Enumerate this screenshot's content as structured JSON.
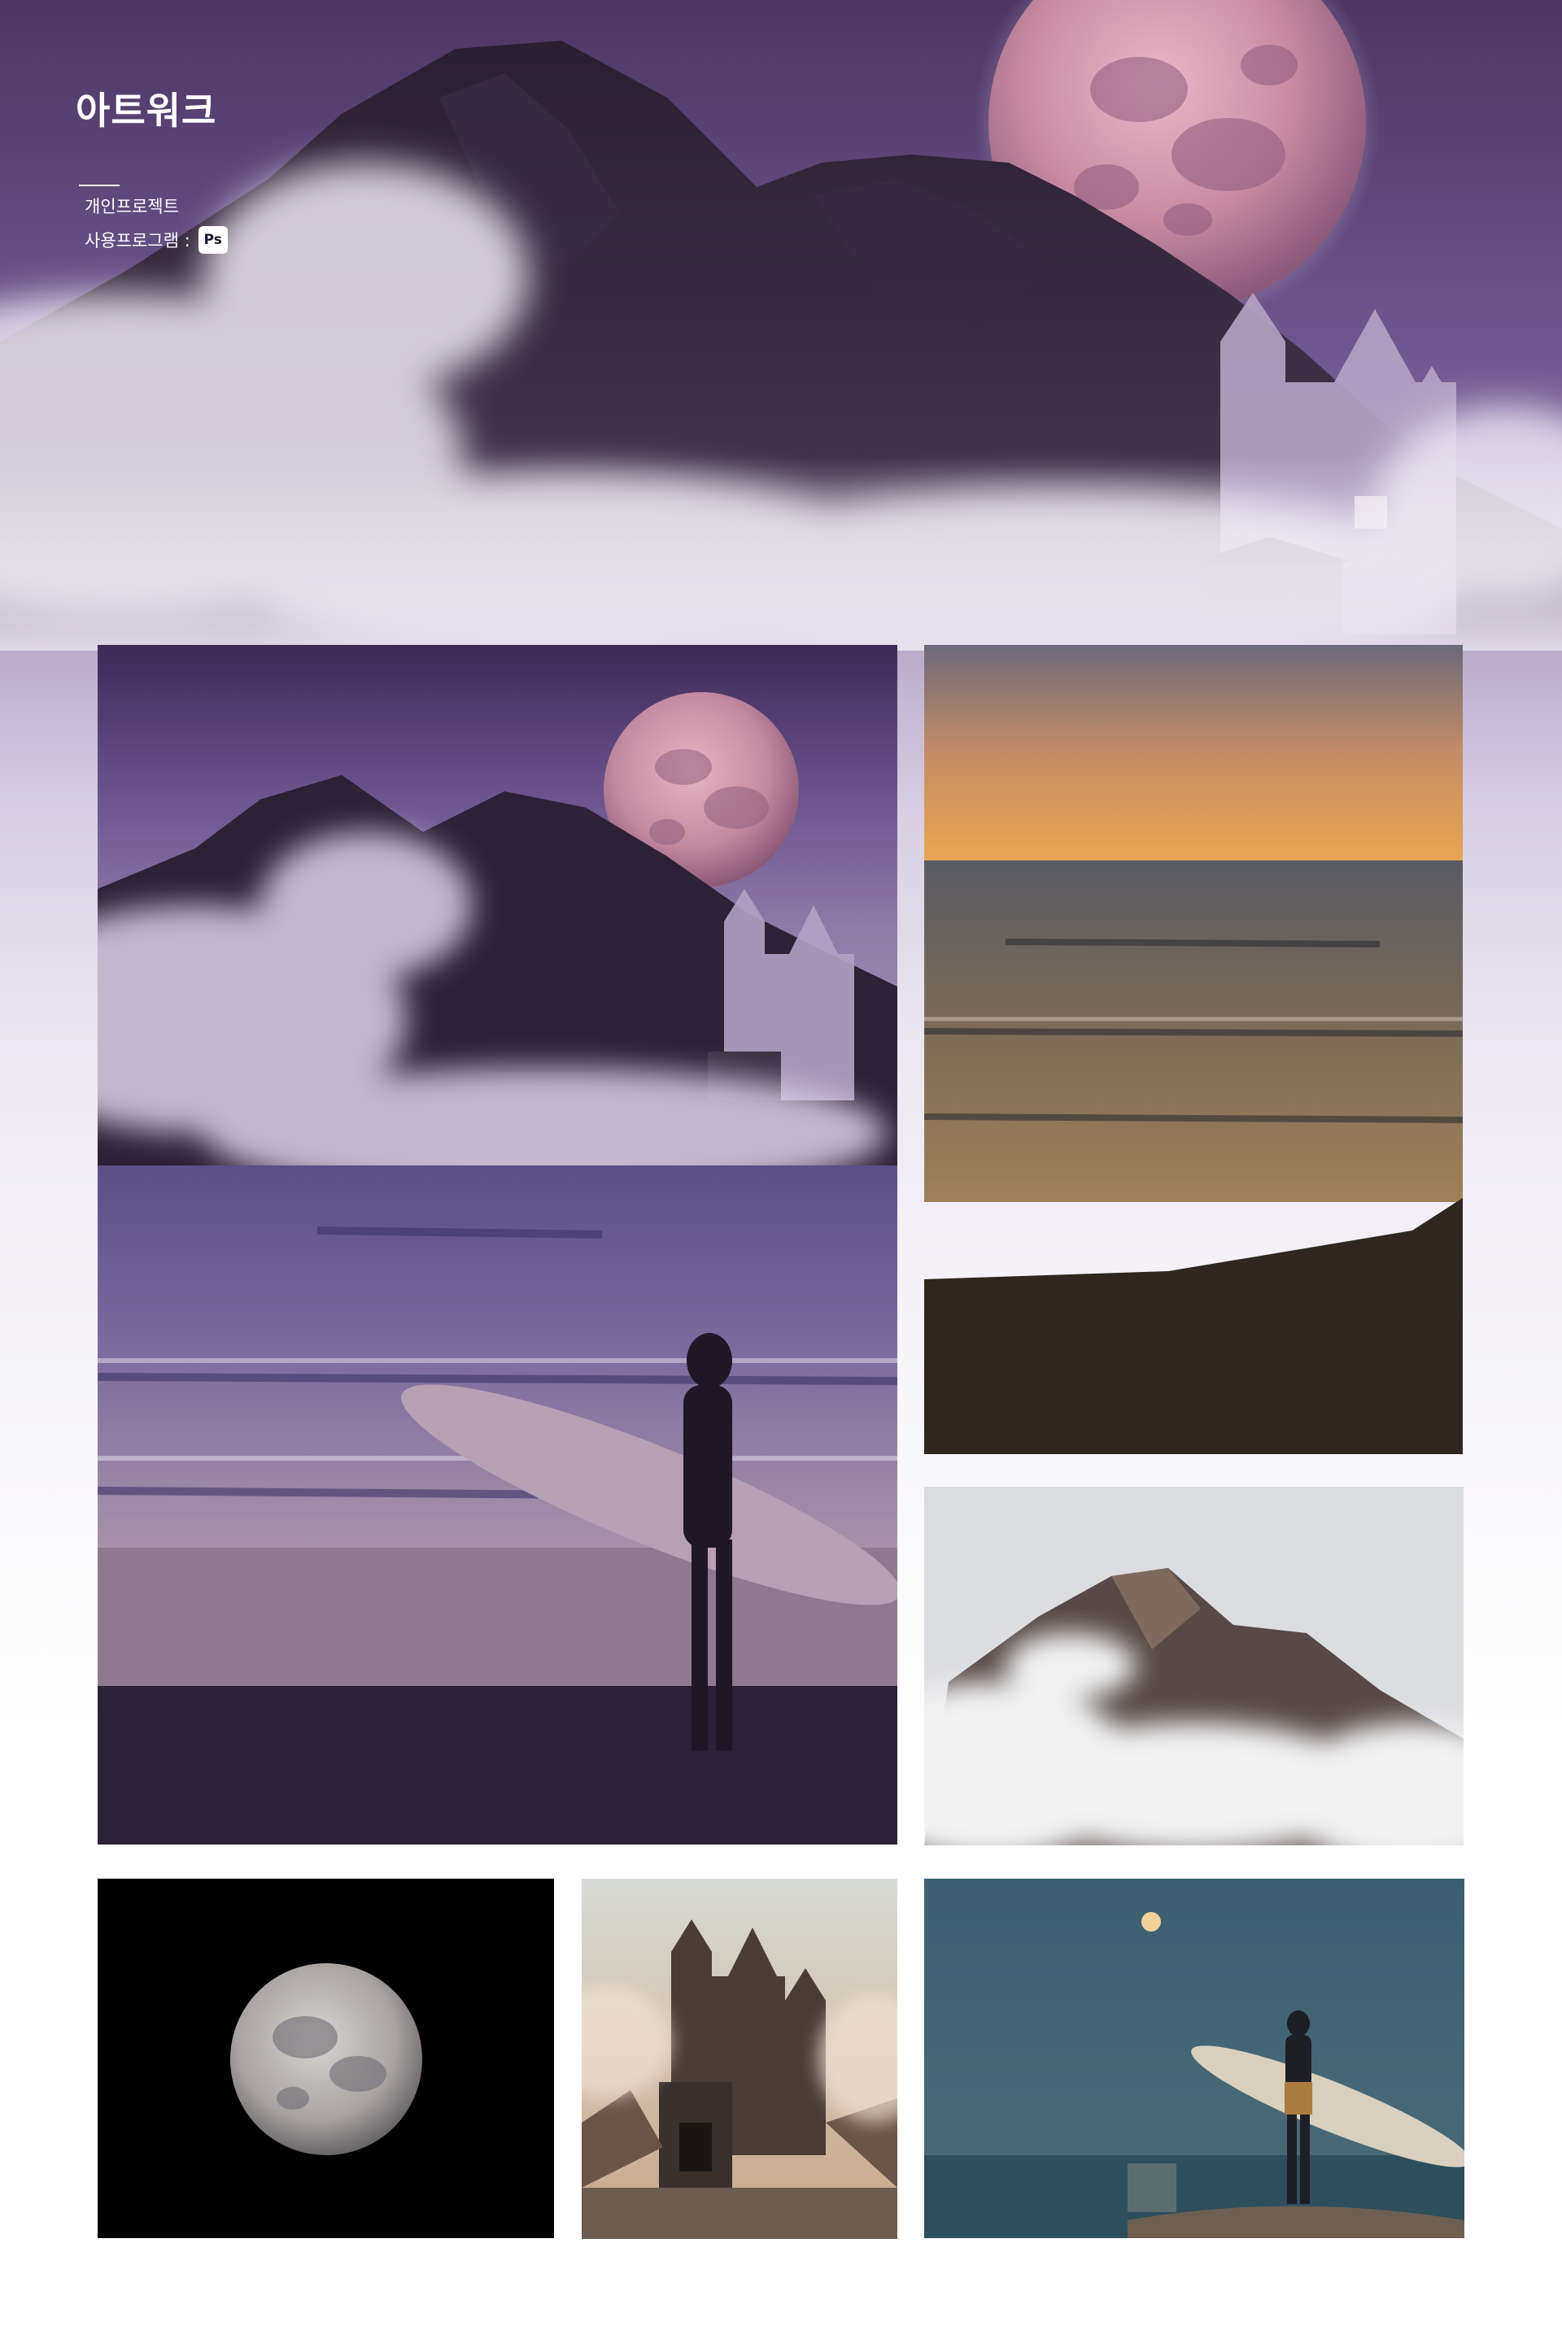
{
  "header": {
    "title": "아트워크",
    "project_type": "개인프로젝트",
    "program_label": "사용프로그램 :",
    "program_badge": "Ps"
  },
  "gallery": {
    "images": [
      {
        "name": "main-artwork-composite",
        "subject": "mountain-castle-moon-surfer-composite"
      },
      {
        "name": "source-sunset-beach",
        "subject": "sunset-beach"
      },
      {
        "name": "source-foggy-mountain",
        "subject": "foggy-mountain"
      },
      {
        "name": "source-full-moon",
        "subject": "full-moon"
      },
      {
        "name": "source-castle",
        "subject": "castle"
      },
      {
        "name": "source-surfer",
        "subject": "surfer-under-moon"
      }
    ]
  },
  "colors": {
    "hero_purple": "#4a3560",
    "accent_moon": "#c9889a",
    "badge_bg": "#ffffff",
    "text_white": "#ffffff"
  }
}
